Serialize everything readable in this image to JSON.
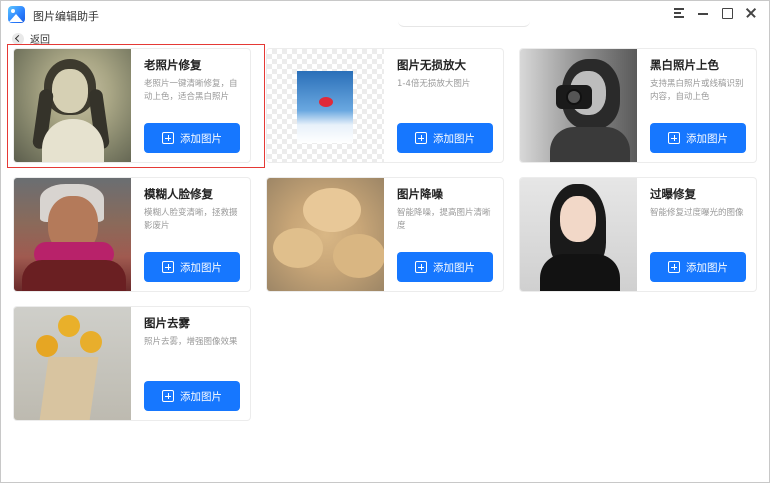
{
  "app": {
    "title": "图片编辑助手"
  },
  "nav": {
    "back_label": "返回"
  },
  "cards": [
    {
      "title": "老照片修复",
      "desc": "老照片一键清晰修复，自动上色，适合黑白照片",
      "button": "添加图片"
    },
    {
      "title": "图片无损放大",
      "desc": "1-4倍无损放大图片",
      "button": "添加图片"
    },
    {
      "title": "黑白照片上色",
      "desc": "支持黑白照片或线稿识别内容，自动上色",
      "button": "添加图片"
    },
    {
      "title": "模糊人脸修复",
      "desc": "模糊人脸变清晰，拯救摄影废片",
      "button": "添加图片"
    },
    {
      "title": "图片降噪",
      "desc": "智能降噪，提高图片清晰度",
      "button": "添加图片"
    },
    {
      "title": "过曝修复",
      "desc": "智能修复过度曝光的图像",
      "button": "添加图片"
    },
    {
      "title": "图片去雾",
      "desc": "照片去雾，增强图像效果",
      "button": "添加图片"
    }
  ],
  "colors": {
    "accent": "#1677ff",
    "highlight": "#e53935"
  }
}
